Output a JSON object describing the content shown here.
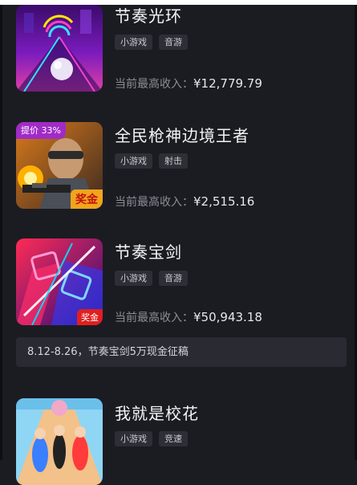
{
  "games": [
    {
      "title": "节奏光环",
      "tags": [
        "小游戏",
        "音游"
      ],
      "income_label": "当前最高收入：",
      "income_value": "¥12,779.79"
    },
    {
      "title": "全民枪神边境王者",
      "tags": [
        "小游戏",
        "射击"
      ],
      "income_label": "当前最高收入：",
      "income_value": "¥2,515.16",
      "badge": "提价 33%",
      "award": "奖金"
    },
    {
      "title": "节奏宝剑",
      "tags": [
        "小游戏",
        "音游"
      ],
      "income_label": "当前最高收入：",
      "income_value": "¥50,943.18",
      "award": "奖金"
    },
    {
      "title": "我就是校花",
      "tags": [
        "小游戏",
        "竞速"
      ]
    }
  ],
  "banner": {
    "text": "8.12-8.26，节奏宝剑5万现金征稿"
  },
  "colors": {
    "background": "#1b1c22",
    "tag_bg": "#2e2f36",
    "badge_purple": "#a12bc7",
    "award_red": "#e01f1f",
    "award_yellow": "#f2a41c"
  }
}
